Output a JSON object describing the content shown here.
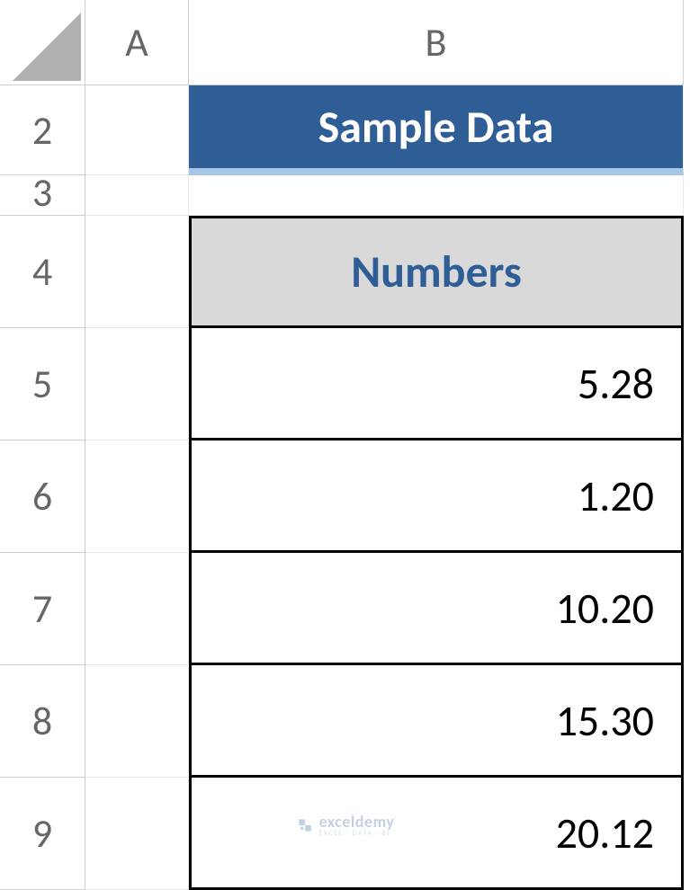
{
  "columns": {
    "a": "A",
    "b": "B"
  },
  "rows": {
    "r2": "2",
    "r3": "3",
    "r4": "4",
    "r5": "5",
    "r6": "6",
    "r7": "7",
    "r8": "8",
    "r9": "9"
  },
  "title": "Sample Data",
  "table": {
    "header": "Numbers",
    "values": [
      "5.28",
      "1.20",
      "10.20",
      "15.30",
      "20.12"
    ]
  },
  "watermark": {
    "main": "exceldemy",
    "sub": "EXCEL · DATA · BI"
  }
}
